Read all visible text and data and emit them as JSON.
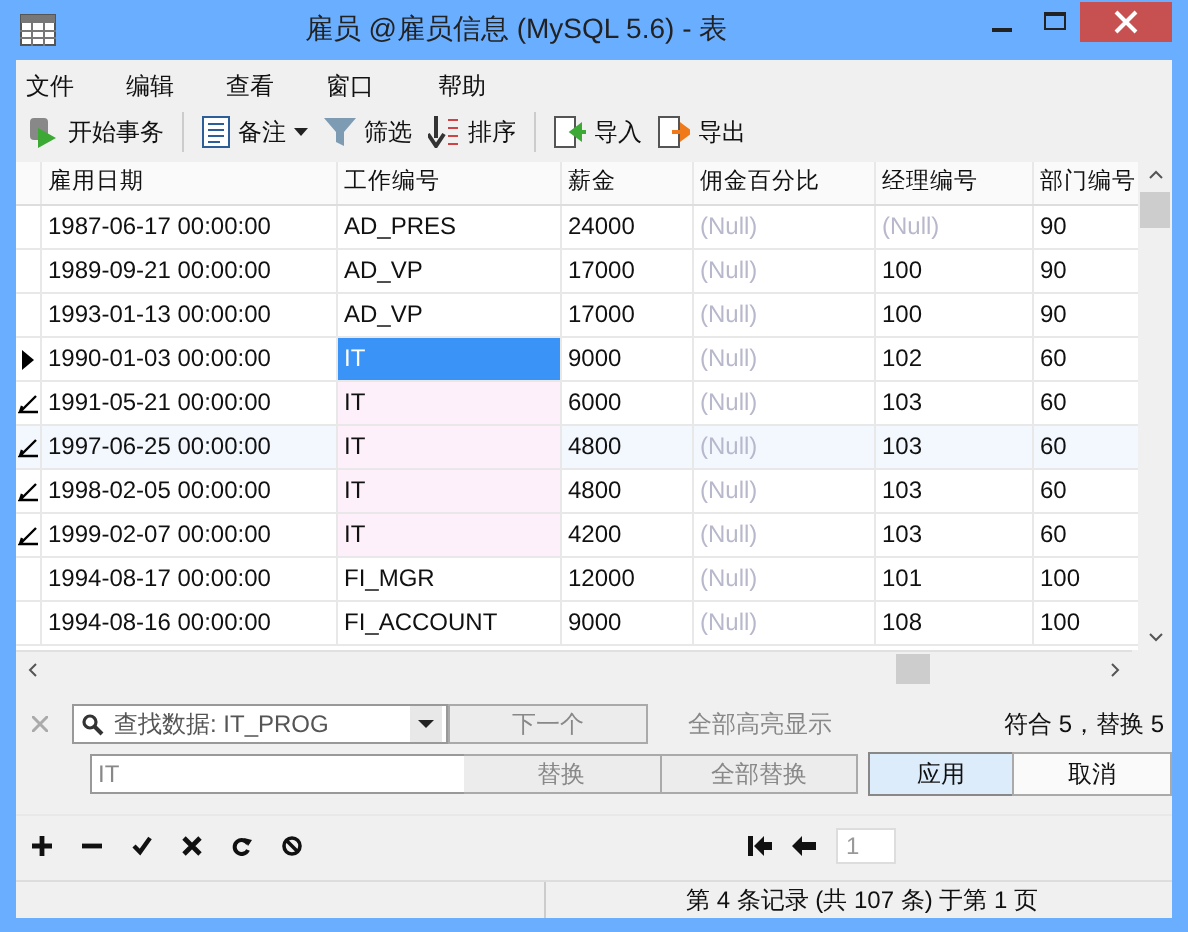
{
  "window": {
    "title": "雇员 @雇员信息 (MySQL 5.6) - 表"
  },
  "menu": [
    "文件",
    "编辑",
    "查看",
    "窗口",
    "帮助"
  ],
  "toolbar": [
    {
      "kind": "transaction",
      "label": "开始事务"
    },
    {
      "kind": "memo",
      "label": "备注"
    },
    {
      "kind": "filter",
      "label": "筛选"
    },
    {
      "kind": "sort",
      "label": "排序"
    },
    {
      "kind": "import",
      "label": "导入"
    },
    {
      "kind": "export",
      "label": "导出"
    }
  ],
  "table": {
    "columns": [
      "雇用日期",
      "工作编号",
      "薪金",
      "佣金百分比",
      "经理编号",
      "部门编号"
    ],
    "rows": [
      {
        "current": false,
        "edited": false,
        "highlighted": false,
        "cells": [
          "1987-06-17 00:00:00",
          "AD_PRES",
          "24000",
          {
            "text": "(Null)",
            "null": true
          },
          {
            "text": "(Null)",
            "null": true
          },
          "90"
        ]
      },
      {
        "current": false,
        "edited": false,
        "highlighted": false,
        "cells": [
          "1989-09-21 00:00:00",
          "AD_VP",
          "17000",
          {
            "text": "(Null)",
            "null": true
          },
          "100",
          "90"
        ]
      },
      {
        "current": false,
        "edited": false,
        "highlighted": false,
        "cells": [
          "1993-01-13 00:00:00",
          "AD_VP",
          "17000",
          {
            "text": "(Null)",
            "null": true
          },
          "100",
          "90"
        ]
      },
      {
        "current": true,
        "edited": false,
        "highlighted": false,
        "cells": [
          "1990-01-03 00:00:00",
          "IT",
          "9000",
          {
            "text": "(Null)",
            "null": true
          },
          "102",
          "60"
        ]
      },
      {
        "current": false,
        "edited": true,
        "highlighted": false,
        "cells": [
          "1991-05-21 00:00:00",
          "IT",
          "6000",
          {
            "text": "(Null)",
            "null": true
          },
          "103",
          "60"
        ]
      },
      {
        "current": false,
        "edited": true,
        "highlighted": true,
        "cells": [
          "1997-06-25 00:00:00",
          "IT",
          "4800",
          {
            "text": "(Null)",
            "null": true
          },
          "103",
          "60"
        ]
      },
      {
        "current": false,
        "edited": true,
        "highlighted": false,
        "cells": [
          "1998-02-05 00:00:00",
          "IT",
          "4800",
          {
            "text": "(Null)",
            "null": true
          },
          "103",
          "60"
        ]
      },
      {
        "current": false,
        "edited": true,
        "highlighted": false,
        "cells": [
          "1999-02-07 00:00:00",
          "IT",
          "4200",
          {
            "text": "(Null)",
            "null": true
          },
          "103",
          "60"
        ]
      },
      {
        "current": false,
        "edited": false,
        "highlighted": false,
        "cells": [
          "1994-08-17 00:00:00",
          "FI_MGR",
          "12000",
          {
            "text": "(Null)",
            "null": true
          },
          "101",
          "100"
        ]
      },
      {
        "current": false,
        "edited": false,
        "highlighted": false,
        "cells": [
          "1994-08-16 00:00:00",
          "FI_ACCOUNT",
          "9000",
          {
            "text": "(Null)",
            "null": true
          },
          "108",
          "100"
        ]
      }
    ]
  },
  "find": {
    "search_value": "查找数据: IT_PROG",
    "next_button": "下一个",
    "highlight_all": "全部高亮显示",
    "result": "符合 5，替换 5",
    "replace_value": "IT",
    "replace_button": "替换",
    "replace_all_button": "全部替换",
    "apply_button": "应用",
    "cancel_button": "取消"
  },
  "edit_tools": [
    {
      "kind": "add"
    },
    {
      "kind": "remove"
    },
    {
      "kind": "apply"
    },
    {
      "kind": "discard"
    },
    {
      "kind": "refresh"
    },
    {
      "kind": "stop"
    }
  ],
  "pager": {
    "page": "1"
  },
  "status_bar": "第 4 条记录 (共 107 条) 于第 1 页"
}
